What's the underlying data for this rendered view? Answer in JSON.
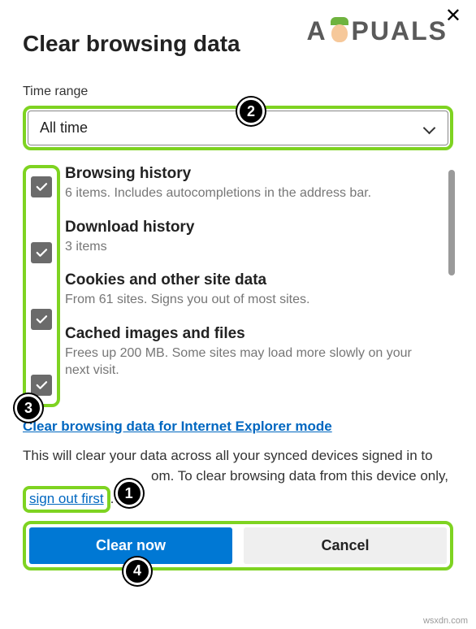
{
  "watermark": "APPUALS",
  "title": "Clear browsing data",
  "time_range_label": "Time range",
  "time_range_value": "All time",
  "items": [
    {
      "title": "Browsing history",
      "desc": "6 items. Includes autocompletions in the address bar."
    },
    {
      "title": "Download history",
      "desc": "3 items"
    },
    {
      "title": "Cookies and other site data",
      "desc": "From 61 sites. Signs you out of most sites."
    },
    {
      "title": "Cached images and files",
      "desc": "Frees up 200 MB. Some sites may load more slowly on your next visit."
    }
  ],
  "ie_link": "Clear browsing data for Internet Explorer mode",
  "para_pre": "This will clear your data across all your synced devices signed in to ",
  "para_mid": "om. To clear browsing data from this device only, ",
  "signout": "sign out first",
  "period": ".",
  "clear_label": "Clear now",
  "cancel_label": "Cancel",
  "markers": {
    "m1": "1",
    "m2": "2",
    "m3": "3",
    "m4": "4"
  },
  "attribution": "wsxdn.com"
}
